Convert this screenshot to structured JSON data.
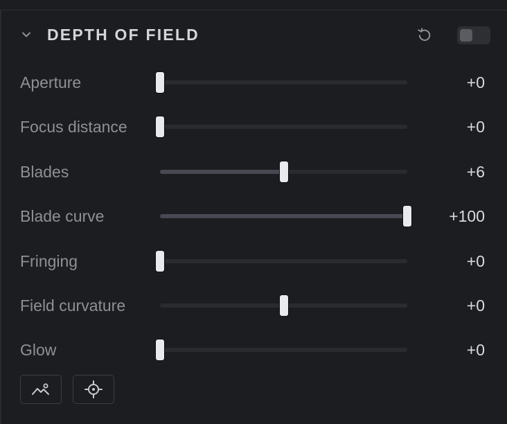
{
  "section": {
    "title": "DEPTH OF FIELD",
    "icons": {
      "collapse": "chevron-down-icon",
      "reset": "reset-icon",
      "toggle_state": "off"
    }
  },
  "sliders": [
    {
      "label": "Aperture",
      "value_text": "+0",
      "fraction": 0.0,
      "fill_from": 0.0
    },
    {
      "label": "Focus distance",
      "value_text": "+0",
      "fraction": 0.0,
      "fill_from": 0.0
    },
    {
      "label": "Blades",
      "value_text": "+6",
      "fraction": 0.5,
      "fill_from": 0.0
    },
    {
      "label": "Blade curve",
      "value_text": "+100",
      "fraction": 1.0,
      "fill_from": 0.0
    },
    {
      "label": "Fringing",
      "value_text": "+0",
      "fraction": 0.0,
      "fill_from": 0.0
    },
    {
      "label": "Field curvature",
      "value_text": "+0",
      "fraction": 0.5,
      "fill_from": 0.5
    },
    {
      "label": "Glow",
      "value_text": "+0",
      "fraction": 0.0,
      "fill_from": 0.0
    }
  ],
  "tools": [
    {
      "icon": "landscape-icon"
    },
    {
      "icon": "crosshair-icon"
    }
  ],
  "colors": {
    "background": "#1c1d20",
    "track": "#2a2b2f",
    "track_fill": "#464951",
    "thumb": "#e8eaee",
    "label": "#8e9096",
    "value": "#d9dbe0",
    "title": "#d4d6db"
  }
}
